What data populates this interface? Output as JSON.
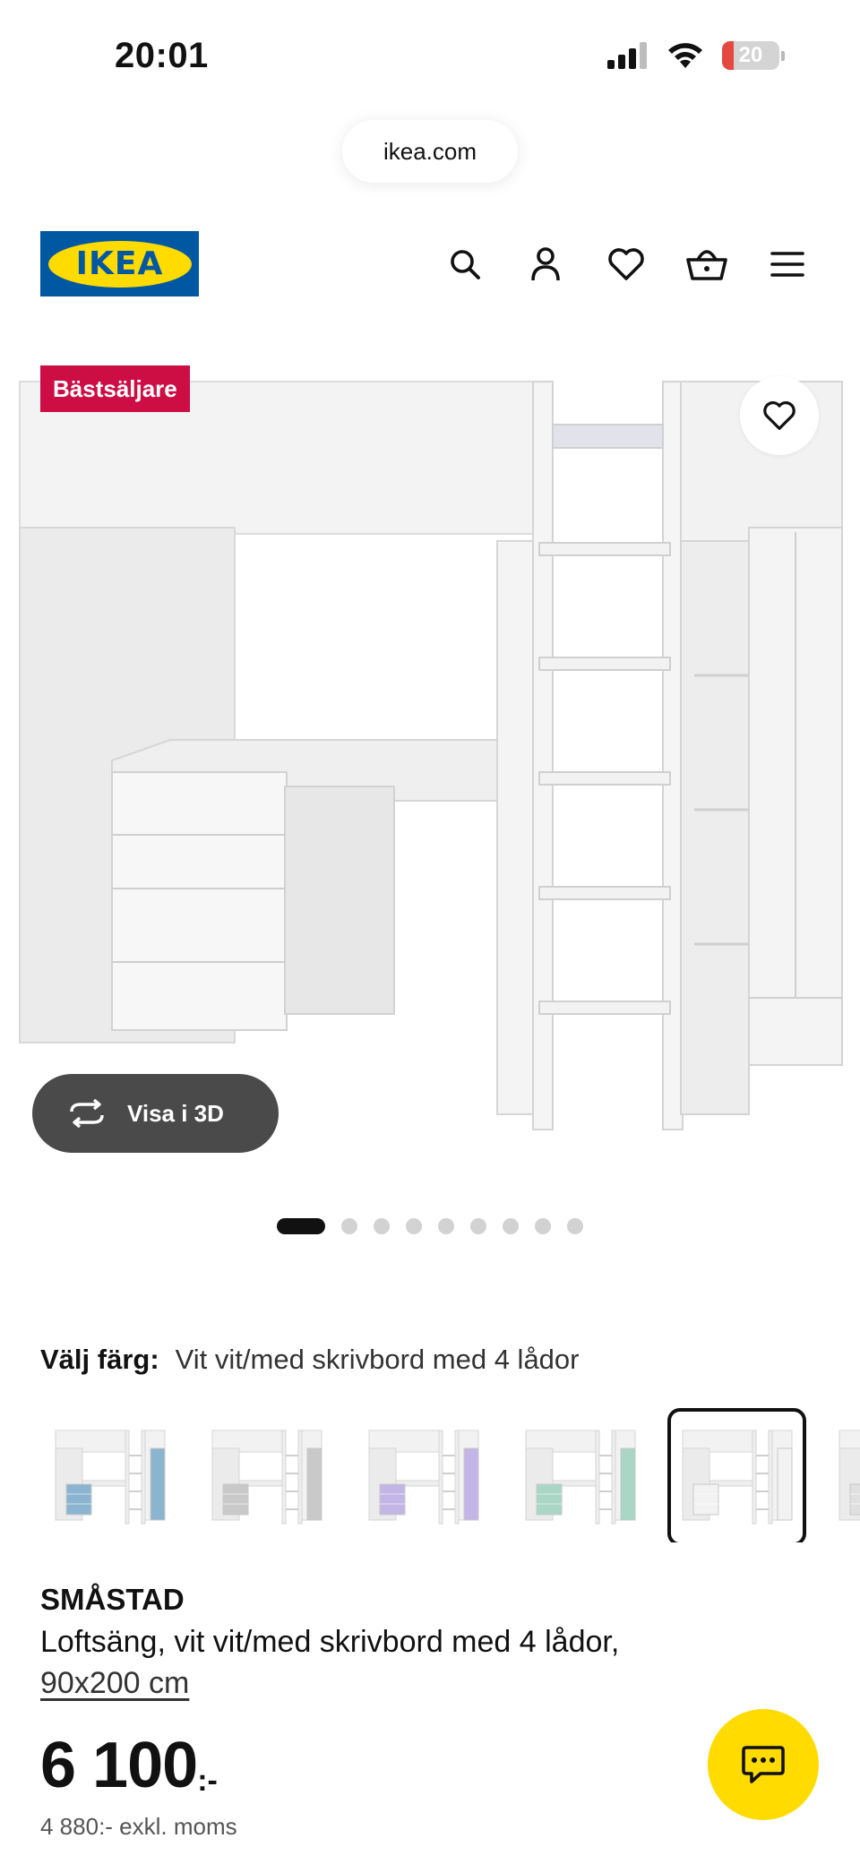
{
  "status_bar": {
    "time": "20:01",
    "battery_level": "20"
  },
  "browser": {
    "url": "ikea.com"
  },
  "header": {
    "logo_text": "IKEA",
    "icons": [
      "search-icon",
      "account-icon",
      "favorites-icon",
      "cart-icon",
      "menu-icon"
    ]
  },
  "product_media": {
    "badge": "Bästsäljare",
    "view_3d_label": "Visa i 3D",
    "image_count": 9,
    "active_image": 1
  },
  "color_picker": {
    "label": "Välj färg:",
    "selected_value": "Vit vit/med skrivbord med 4 lådor",
    "options": [
      {
        "accent": "#8ab4d0",
        "selected": false
      },
      {
        "accent": "#c9c9c9",
        "selected": false
      },
      {
        "accent": "#c3b5e6",
        "selected": false
      },
      {
        "accent": "#a9d6c5",
        "selected": false
      },
      {
        "accent": "#f2f2f2",
        "selected": true
      },
      {
        "accent": "#e0e0e0",
        "selected": false
      }
    ]
  },
  "product": {
    "name": "SMÅSTAD",
    "description": "Loftsäng, vit vit/med skrivbord med 4 lådor,",
    "size": "90x200 cm",
    "price": "6 100",
    "price_suffix": ":-",
    "price_excl_vat": "4 880:- exkl. moms"
  },
  "colors": {
    "brand_blue": "#0058a3",
    "brand_yellow": "#ffdb00",
    "badge_red": "#cc0e45"
  }
}
